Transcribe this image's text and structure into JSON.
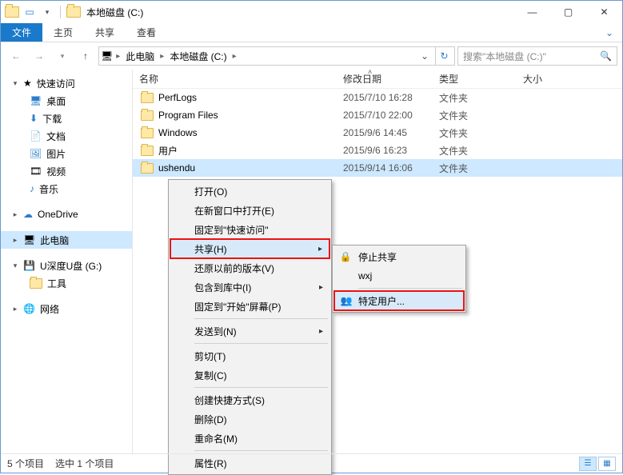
{
  "title": "本地磁盘 (C:)",
  "ribbon": {
    "file": "文件",
    "tabs": [
      "主页",
      "共享",
      "查看"
    ]
  },
  "breadcrumbs": [
    "此电脑",
    "本地磁盘 (C:)"
  ],
  "search_placeholder": "搜索\"本地磁盘 (C:)\"",
  "columns": {
    "name": "名称",
    "date": "修改日期",
    "type": "类型",
    "size": "大小"
  },
  "sidebar": {
    "quick": {
      "label": "快速访问",
      "items": [
        "桌面",
        "下载",
        "文档",
        "图片",
        "视频",
        "音乐"
      ]
    },
    "onedrive": "OneDrive",
    "thispc": "此电脑",
    "drive": {
      "label": "U深度U盘 (G:)",
      "items": [
        "工具"
      ]
    },
    "network": "网络"
  },
  "rows": [
    {
      "name": "PerfLogs",
      "date": "2015/7/10 16:28",
      "type": "文件夹"
    },
    {
      "name": "Program Files",
      "date": "2015/7/10 22:00",
      "type": "文件夹"
    },
    {
      "name": "Windows",
      "date": "2015/9/6 14:45",
      "type": "文件夹"
    },
    {
      "name": "用户",
      "date": "2015/9/6 16:23",
      "type": "文件夹"
    },
    {
      "name": "ushendu",
      "date": "2015/9/14 16:06",
      "type": "文件夹"
    }
  ],
  "ctx1": {
    "open": "打开(O)",
    "newwin": "在新窗口中打开(E)",
    "pinquick": "固定到\"快速访问\"",
    "share": "共享(H)",
    "restore": "还原以前的版本(V)",
    "include": "包含到库中(I)",
    "pinstart": "固定到\"开始\"屏幕(P)",
    "sendto": "发送到(N)",
    "cut": "剪切(T)",
    "copy": "复制(C)",
    "shortcut": "创建快捷方式(S)",
    "delete": "删除(D)",
    "rename": "重命名(M)",
    "props": "属性(R)"
  },
  "ctx2": {
    "stop": "停止共享",
    "wxj": "wxj",
    "specific": "特定用户..."
  },
  "status": {
    "count": "5 个项目",
    "sel": "选中 1 个项目"
  }
}
